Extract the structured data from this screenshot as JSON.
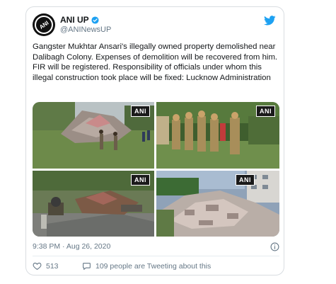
{
  "tweet": {
    "display_name": "ANI UP",
    "handle": "@ANINewsUP",
    "avatar_text": "ANI",
    "text": "Gangster Mukhtar Ansari's illegally owned property demolished near Dalibagh Colony. Expenses of demolition will be recovered from him. FIR will be registered. Responsibility of officials under whom this illegal construction took place will be fixed: Lucknow Administration",
    "photos": [
      {
        "badge": "ANI"
      },
      {
        "badge": "ANI"
      },
      {
        "badge": "ANI"
      },
      {
        "badge": "ANI"
      }
    ],
    "timestamp": "9:38 PM · Aug 26, 2020",
    "likes": "513",
    "people_tweeting": "109 people are Tweeting about this"
  },
  "colors": {
    "twitter_blue": "#1da1f2",
    "text": "#14171a",
    "secondary": "#657786",
    "border": "#d9dde1"
  },
  "icons": [
    "verified-badge-icon",
    "twitter-bird-icon",
    "info-icon",
    "heart-icon",
    "speech-bubble-icon"
  ]
}
